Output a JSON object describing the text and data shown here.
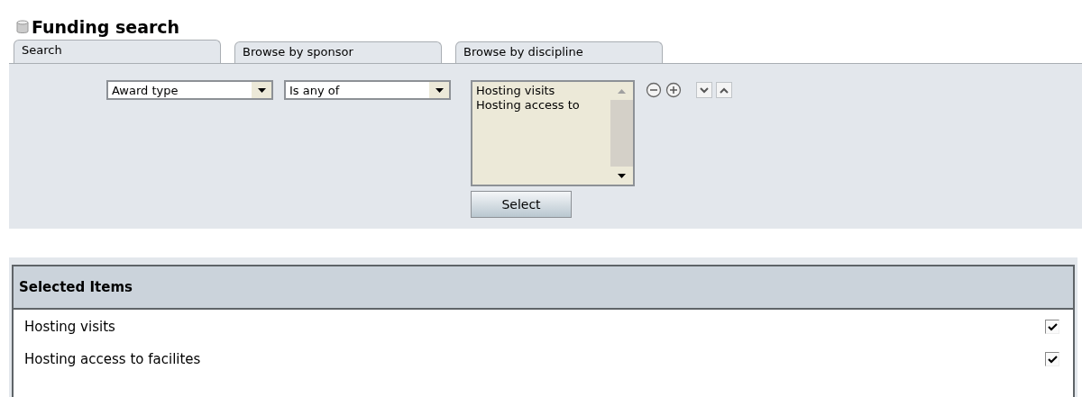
{
  "title": "Funding search",
  "tabs": [
    {
      "label": "Search",
      "selected": true
    },
    {
      "label": "Browse by sponsor",
      "selected": false
    },
    {
      "label": "Browse by discipline",
      "selected": false
    }
  ],
  "filter": {
    "field": "Award type",
    "operator": "Is any of",
    "options": [
      "Hosting visits",
      "Hosting access to"
    ],
    "select_button": "Select"
  },
  "selected_items": {
    "title": "Selected Items",
    "rows": [
      {
        "label": "Hosting visits",
        "checked": true
      },
      {
        "label": "Hosting access to facilites",
        "checked": true
      }
    ]
  }
}
